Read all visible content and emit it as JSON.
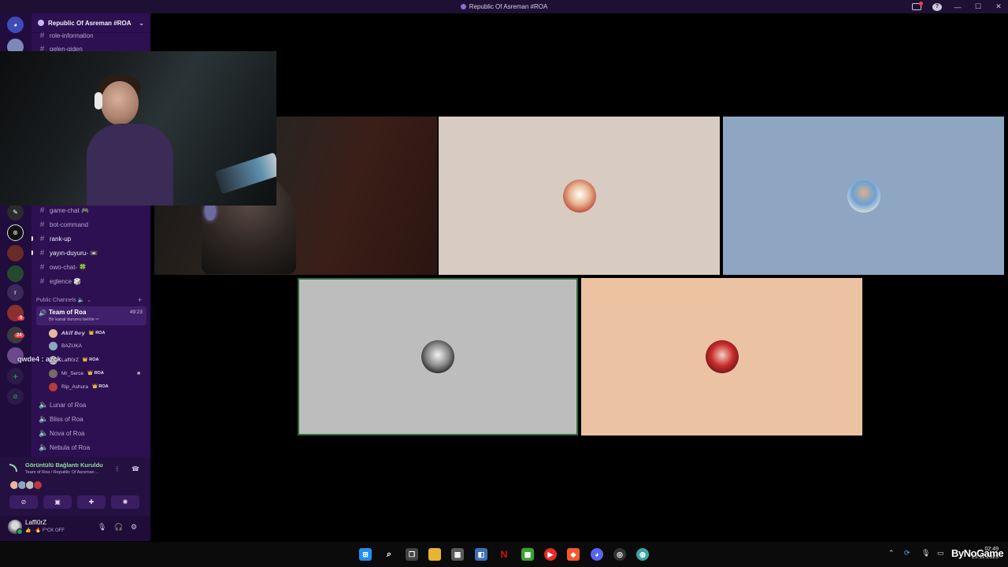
{
  "window": {
    "title": "Republic Of Asreman #ROA"
  },
  "server": {
    "name": "Republic Of Asreman #ROA"
  },
  "channels": {
    "top": [
      "role-information",
      "gelen-giden"
    ],
    "text": [
      "game-chat 🎮",
      "bot-command",
      "rank-up",
      "yayın-duyuru- 📼",
      "owo-chat- 🍀",
      "eglence 🎲"
    ],
    "category": "Public Channels 🔈",
    "voice_active": {
      "name": "Team of Roa",
      "subtitle": "Bir kanal durumu belirle ✏",
      "timer": "49:23"
    },
    "members": [
      {
        "name": "𝘼𝙠𝙞𝙛 𝘽𝙚𝙮",
        "tag": "👑 ROA"
      },
      {
        "name": "BAZUKA",
        "tag": ""
      },
      {
        "name": "Laffi0rZ",
        "tag": "👑 ROA"
      },
      {
        "name": "Mr_Serce",
        "tag": "👑 ROA"
      },
      {
        "name": "Rip_Ashura",
        "tag": "👑 ROA"
      }
    ],
    "voice_other": [
      "Lunar of Roa",
      "Bliss of Roa",
      "Nova of Roa",
      "Nebula of Roa"
    ]
  },
  "rail": {
    "badge_1": "24",
    "badge_2": "9",
    "letter_server": "r"
  },
  "voice_panel": {
    "status": "Görüntülü Bağlantı Kuruldu",
    "location": "Team of Roa / Republic Of Asreman ..."
  },
  "user": {
    "name": "Laffi0rZ",
    "status": "👍 · 🔥 F*CK OFF"
  },
  "overlay": {
    "chat_line": "qwde4 : azck",
    "watermark": "ByNoGame"
  },
  "clock": {
    "time": "02:49",
    "date": "15.11.2025"
  },
  "colors": {
    "sidebar": "#2d1052",
    "rail": "#200c3d",
    "tile_beige": "#d8cbc1",
    "tile_blue": "#8ea6c2",
    "tile_grey": "#bdbdbd",
    "tile_peach": "#ebc3a2",
    "speaking_border": "#2f6d3d"
  }
}
